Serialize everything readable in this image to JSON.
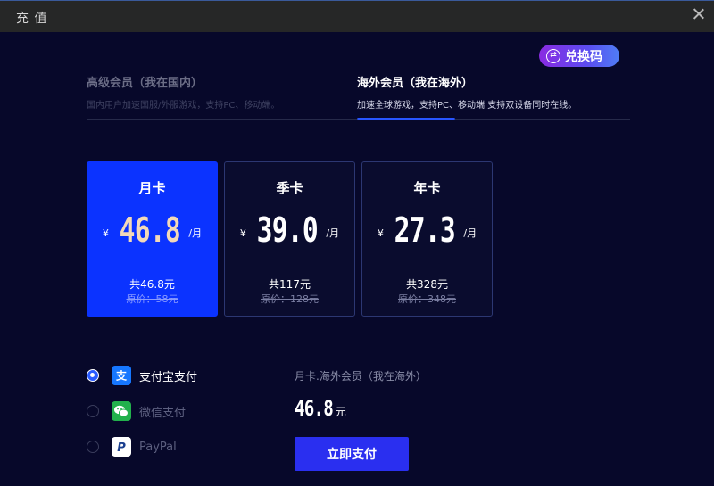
{
  "window": {
    "title": "充 值"
  },
  "redeem": {
    "label": "兑换码",
    "icon": "exchange-icon"
  },
  "tabs": [
    {
      "label": "高级会员（我在国内）",
      "desc": "国内用户加速国服/外服游戏，支持PC、移动端。",
      "active": false
    },
    {
      "label": "海外会员（我在海外）",
      "desc": "加速全球游戏，支持PC、移动端 支持双设备同时在线。",
      "active": true
    }
  ],
  "plans": [
    {
      "name": "月卡",
      "currency": "¥",
      "price": "46.8",
      "per": "/月",
      "total": "共46.8元",
      "original": "原价：58元",
      "selected": true
    },
    {
      "name": "季卡",
      "currency": "¥",
      "price": "39.0",
      "per": "/月",
      "total": "共117元",
      "original": "原价：128元",
      "selected": false
    },
    {
      "name": "年卡",
      "currency": "¥",
      "price": "27.3",
      "per": "/月",
      "total": "共328元",
      "original": "原价：348元",
      "selected": false
    }
  ],
  "payment": [
    {
      "label": "支付宝支付",
      "icon": "alipay-icon",
      "icon_text": "支",
      "color": "#1677ff",
      "checked": true
    },
    {
      "label": "微信支付",
      "icon": "wechat-icon",
      "icon_text": "",
      "color": "#22b14c",
      "checked": false
    },
    {
      "label": "PayPal",
      "icon": "paypal-icon",
      "icon_text": "P",
      "color": "#ffffff",
      "checked": false
    }
  ],
  "summary": {
    "product": "月卡.海外会员（我在海外）",
    "amount": "46.8",
    "unit": "元",
    "pay_label": "立即支付"
  },
  "colors": {
    "accent": "#0b33ff",
    "background": "#07082a",
    "price_highlight": "#f3d9b8"
  }
}
